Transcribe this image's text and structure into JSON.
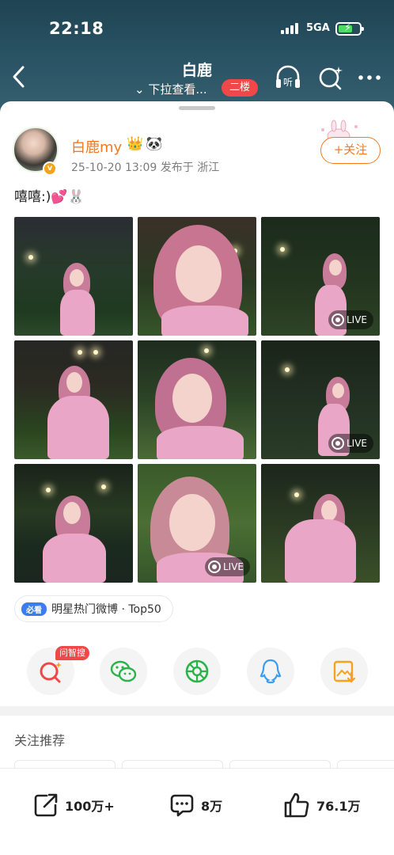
{
  "status": {
    "time": "22:18",
    "network": "5GA"
  },
  "nav": {
    "title": "白鹿",
    "subtitle": "⌄ 下拉查看...",
    "floor_badge": "二楼"
  },
  "post": {
    "username": "白鹿my",
    "meta": "25-10-20 13:09  发布于 浙江",
    "follow_label": "+关注",
    "text": "嘻嘻:)💕🐰",
    "live_label": "LIVE",
    "tag_badge": "必看",
    "tag_text": "明星热门微博 · Top50"
  },
  "share": {
    "ask_badge": "问智搜"
  },
  "recommend": {
    "title": "关注推荐"
  },
  "actions": {
    "repost": "100万+",
    "comment": "8万",
    "like": "76.1万"
  },
  "colors": {
    "accent": "#f57a1e",
    "header_bg": "#2b5566",
    "badge_red": "#f04848"
  }
}
